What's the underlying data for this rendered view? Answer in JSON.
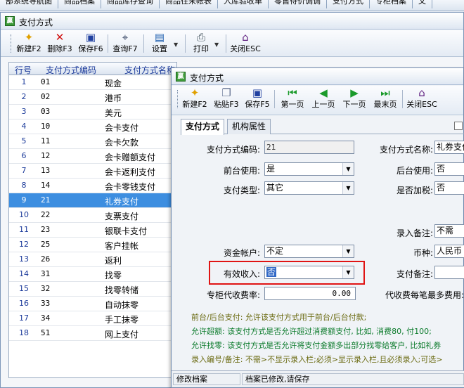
{
  "top_tabs": [
    "部系统导航图",
    "商品档案",
    "商品库存查询",
    "商品往来帐表",
    "入库验收单",
    "零售待价调调",
    "支付方式",
    "专柜档案",
    "文"
  ],
  "main": {
    "title": "支付方式",
    "toolbar": {
      "new": "新建F2",
      "delete": "删除F3",
      "save": "保存F6",
      "query": "查询F7",
      "settings": "设置",
      "print": "打印",
      "close": "关闭ESC"
    },
    "grid": {
      "headers": [
        "行号",
        "支付方式编码",
        "支付方式名称"
      ],
      "rows": [
        [
          "1",
          "01",
          "现金"
        ],
        [
          "2",
          "02",
          "港币"
        ],
        [
          "3",
          "03",
          "美元"
        ],
        [
          "4",
          "10",
          "会卡支付"
        ],
        [
          "5",
          "11",
          "会卡欠款"
        ],
        [
          "6",
          "12",
          "会卡赠额支付"
        ],
        [
          "7",
          "13",
          "会卡返利支付"
        ],
        [
          "8",
          "14",
          "会卡零钱支付"
        ],
        [
          "9",
          "21",
          "礼券支付"
        ],
        [
          "10",
          "22",
          "支票支付"
        ],
        [
          "11",
          "23",
          "银联卡支付"
        ],
        [
          "12",
          "25",
          "客户挂帐"
        ],
        [
          "13",
          "26",
          "返利"
        ],
        [
          "14",
          "31",
          "找零"
        ],
        [
          "15",
          "32",
          "找零转储"
        ],
        [
          "16",
          "33",
          "自动抹零"
        ],
        [
          "17",
          "34",
          "手工抹零"
        ],
        [
          "18",
          "51",
          "网上支付"
        ]
      ],
      "selected_index": 8
    }
  },
  "dialog": {
    "title": "支付方式",
    "toolbar": {
      "new": "新建F2",
      "paste": "粘贴F3",
      "save": "保存F5",
      "first": "第一页",
      "prev": "上一页",
      "next": "下一页",
      "last": "最末页",
      "close": "关闭ESC"
    },
    "tabs": [
      "支付方式",
      "机构属性"
    ],
    "checkbox_label": "新",
    "form": {
      "code_label": "支付方式编码:",
      "code_value": "21",
      "name_label": "支付方式名称:",
      "name_value": "礼券支付",
      "front_label": "前台使用:",
      "front_value": "是",
      "back_label": "后台使用:",
      "back_value": "否",
      "type_label": "支付类型:",
      "type_value": "其它",
      "tax_label": "是否加税:",
      "tax_value": "否",
      "entry_note_label": "录入备注:",
      "entry_note_value": "不需",
      "account_label": "资金帐户:",
      "account_value": "不定",
      "currency_label": "币种:",
      "currency_value": "人民币",
      "income_label": "有效收入:",
      "income_value": "否",
      "pay_note_label": "支付备注:",
      "pay_note_value": "",
      "rate_label": "专柜代收费率:",
      "rate_value": "0.00",
      "max_fee_label": "代收费每笔最多费用:"
    },
    "notes": [
      "前台/后台支付: 允许该支付方式用于前台/后台付款;",
      "允许超额: 该支付方式是否允许超过消费额支付, 比如, 消费80, 付100;",
      "允许找零: 该支付方式是否允许将支付金额多出部分找零给客户, 比如礼券",
      "录入编号/备注: 不需>不显示录入栏;必须>显示录入栏,且必须录入;可选>"
    ],
    "status": {
      "left": "修改档案",
      "right": "档案已修改,请保存"
    }
  },
  "colors": {
    "selection": "#3d8ee0",
    "highlight_border": "#e01414",
    "header_text": "#1b3a9a"
  }
}
